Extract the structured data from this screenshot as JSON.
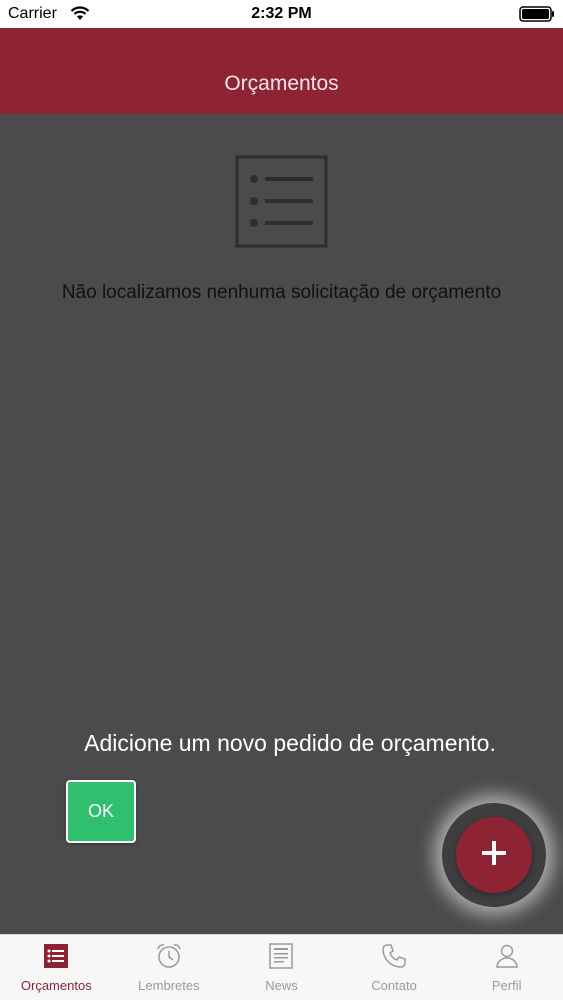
{
  "status_bar": {
    "carrier": "Carrier",
    "time": "2:32 PM",
    "wifi_icon": "wifi-icon",
    "battery_icon": "battery-icon"
  },
  "nav": {
    "title": "Orçamentos"
  },
  "content": {
    "empty_icon": "list-icon",
    "empty_message": "Não localizamos nenhuma solicitação de orçamento"
  },
  "tutorial": {
    "text": "Adicione um novo pedido de orçamento.",
    "ok_label": "OK"
  },
  "fab": {
    "icon": "plus-icon"
  },
  "tab_bar": {
    "tabs": [
      {
        "label": "Orçamentos",
        "icon": "list-icon",
        "active": true
      },
      {
        "label": "Lembretes",
        "icon": "alarm-clock-icon",
        "active": false
      },
      {
        "label": "News",
        "icon": "newspaper-icon",
        "active": false
      },
      {
        "label": "Contato",
        "icon": "phone-icon",
        "active": false
      },
      {
        "label": "Perfil",
        "icon": "person-icon",
        "active": false
      }
    ]
  },
  "colors": {
    "brand": "#8e2433",
    "overlay": "#4b4b4d",
    "ok_button": "#2fbf6f",
    "tab_inactive": "#9a9a9a"
  }
}
